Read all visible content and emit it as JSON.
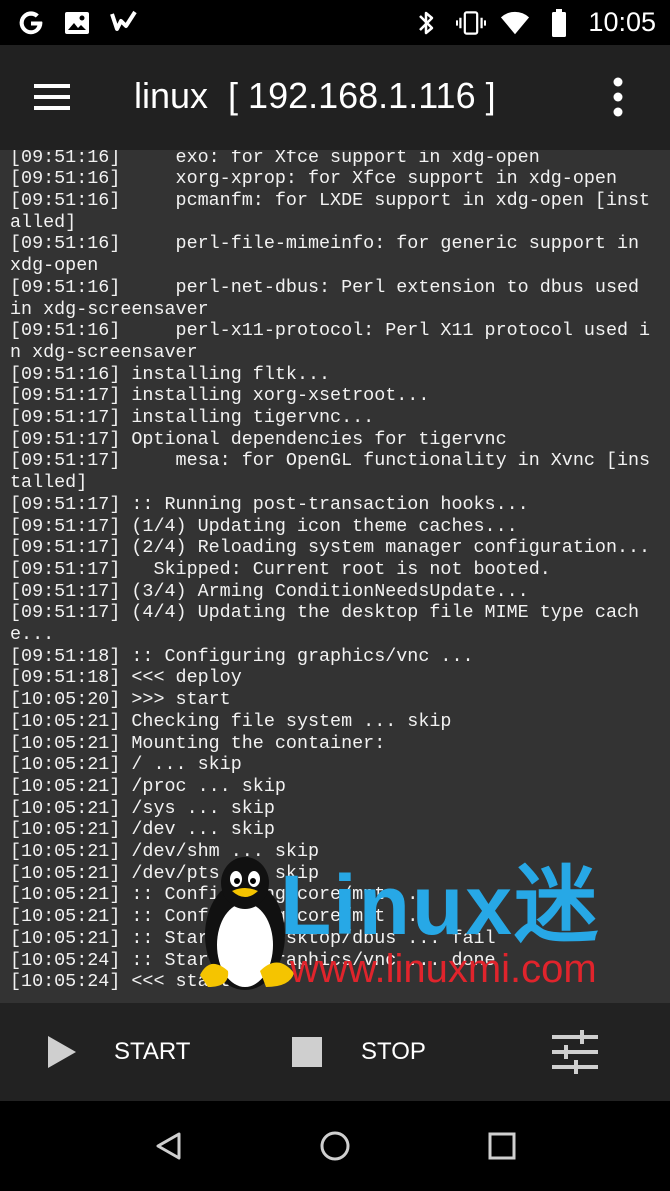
{
  "status_bar": {
    "time": "10:05",
    "left_icons": [
      "google-g-icon",
      "image-icon",
      "check-list-icon"
    ],
    "right_icons": [
      "bluetooth-icon",
      "vibrate-icon",
      "wifi-icon",
      "battery-icon"
    ]
  },
  "app_bar": {
    "title": "linux  [ 192.168.1.116 ]",
    "menu_icon": "hamburger-menu-icon",
    "more_icon": "more-vert-icon",
    "background": "#212121"
  },
  "terminal": {
    "background": "#333333",
    "text_color": "#f2f2f2",
    "lines": [
      "[09:51:16]     exo: for Xfce support in xdg-open",
      "[09:51:16]     xorg-xprop: for Xfce support in xdg-open",
      "[09:51:16]     pcmanfm: for LXDE support in xdg-open [installed]",
      "[09:51:16]     perl-file-mimeinfo: for generic support in xdg-open",
      "[09:51:16]     perl-net-dbus: Perl extension to dbus used in xdg-screensaver",
      "[09:51:16]     perl-x11-protocol: Perl X11 protocol used in xdg-screensaver",
      "[09:51:16] installing fltk...",
      "[09:51:17] installing xorg-xsetroot...",
      "[09:51:17] installing tigervnc...",
      "[09:51:17] Optional dependencies for tigervnc",
      "[09:51:17]     mesa: for OpenGL functionality in Xvnc [installed]",
      "[09:51:17] :: Running post-transaction hooks...",
      "[09:51:17] (1/4) Updating icon theme caches...",
      "[09:51:17] (2/4) Reloading system manager configuration...",
      "[09:51:17]   Skipped: Current root is not booted.",
      "[09:51:17] (3/4) Arming ConditionNeedsUpdate...",
      "[09:51:17] (4/4) Updating the desktop file MIME type cache...",
      "[09:51:18] :: Configuring graphics/vnc ...",
      "[09:51:18] <<< deploy",
      "[10:05:20] >>> start",
      "[10:05:21] Checking file system ... skip",
      "[10:05:21] Mounting the container:",
      "[10:05:21] / ... skip",
      "[10:05:21] /proc ... skip",
      "[10:05:21] /sys ... skip",
      "[10:05:21] /dev ... skip",
      "[10:05:21] /dev/shm ... skip",
      "[10:05:21] /dev/pts ... skip",
      "[10:05:21] :: Configuring core/mnt ...",
      "[10:05:21] :: Configuring core/mnt ...",
      "[10:05:21] :: Starting desktop/dbus ... fail",
      "[10:05:24] :: Starting graphics/vnc ... done",
      "[10:05:24] <<< start"
    ]
  },
  "watermark": {
    "brand": "Linux迷",
    "url": "www.linuxmi.com",
    "brand_color": "#27a8e6",
    "url_color": "#e0242c"
  },
  "bottom_bar": {
    "start_label": "START",
    "stop_label": "STOP",
    "start_icon": "play-icon",
    "stop_icon": "stop-icon",
    "settings_icon": "tune-sliders-icon",
    "background": "#222222"
  },
  "nav_bar": {
    "icons": [
      "back-icon",
      "home-icon",
      "recents-icon"
    ]
  }
}
